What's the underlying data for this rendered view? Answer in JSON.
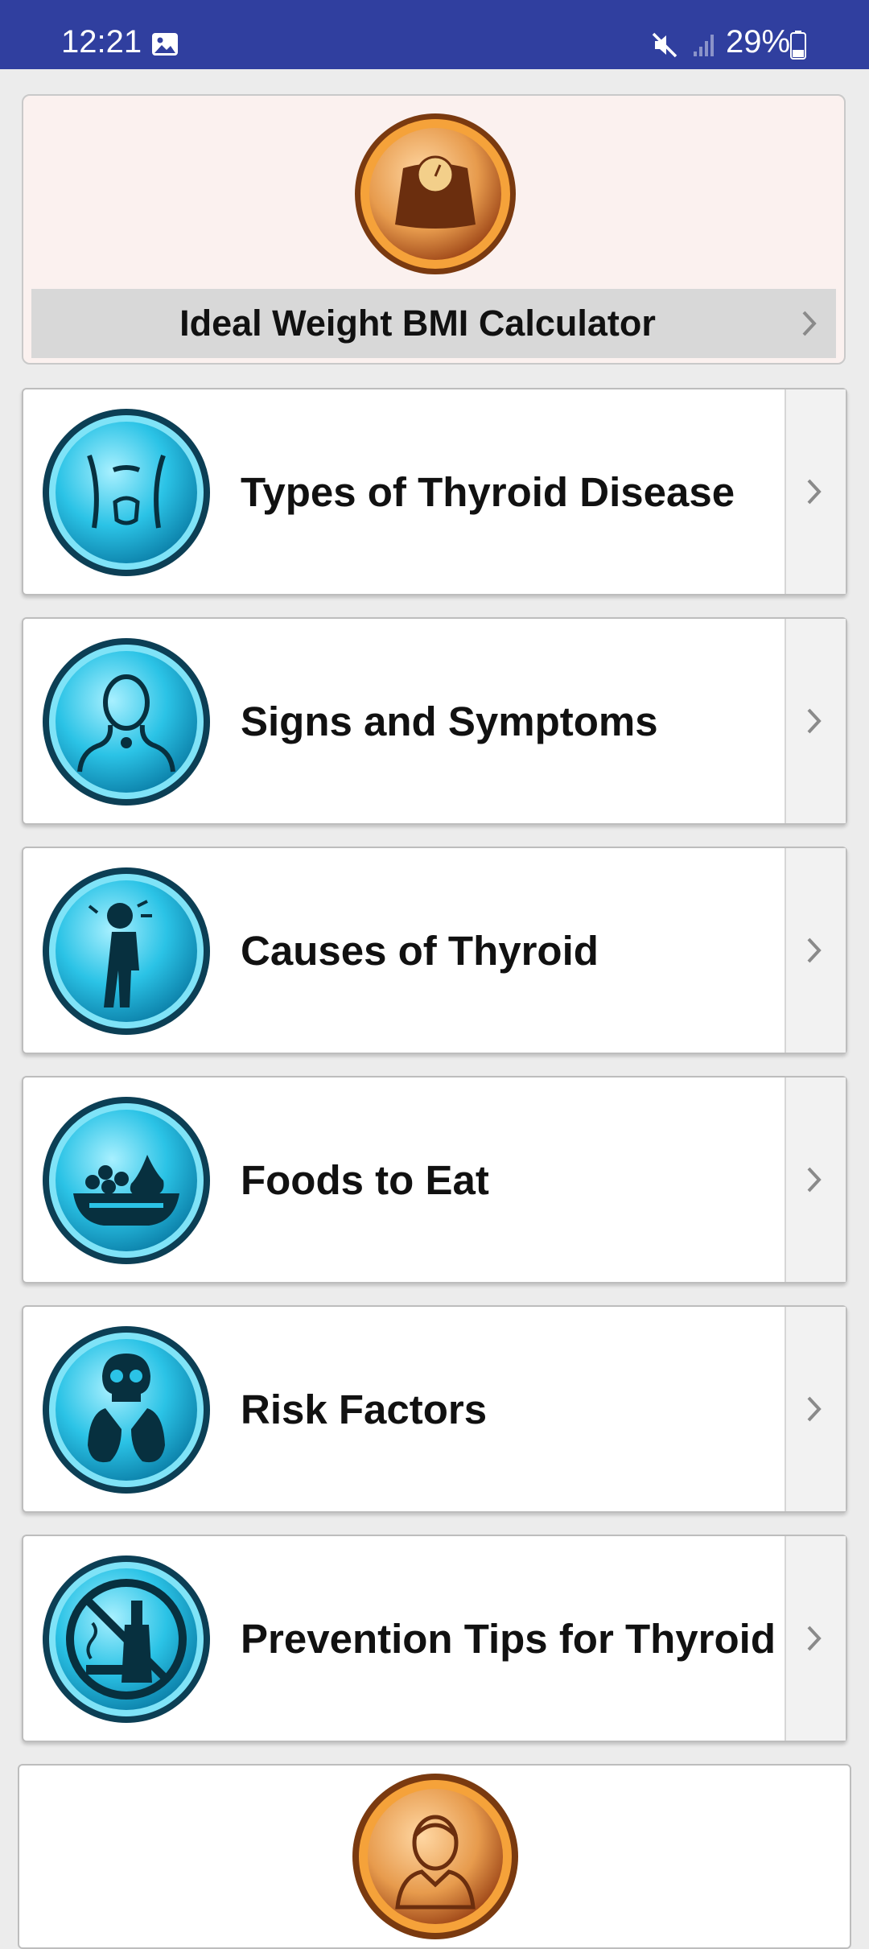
{
  "status_bar": {
    "time": "12:21",
    "battery_percent": "29%",
    "icons": [
      "gallery-icon",
      "mute-icon",
      "signal-icon",
      "battery-icon"
    ]
  },
  "bmi_card": {
    "label": "Ideal Weight BMI Calculator",
    "icon": "scale-icon"
  },
  "menu": {
    "items": [
      {
        "label": "Types of Thyroid Disease",
        "icon": "neck-thyroid-icon"
      },
      {
        "label": "Signs and Symptoms",
        "icon": "person-throat-icon"
      },
      {
        "label": "Causes of Thyroid",
        "icon": "sick-person-icon"
      },
      {
        "label": "Foods to Eat",
        "icon": "fruit-bowl-icon"
      },
      {
        "label": "Risk Factors",
        "icon": "skull-thyroid-icon"
      },
      {
        "label": "Prevention Tips for Thyroid",
        "icon": "no-smoking-drinking-icon"
      }
    ]
  },
  "doctor_card": {
    "icon": "doctor-icon"
  },
  "colors": {
    "status_bar": "#303f9f",
    "menu_icon": "#2ab8d8",
    "emblem_orange": "#c8682a"
  }
}
